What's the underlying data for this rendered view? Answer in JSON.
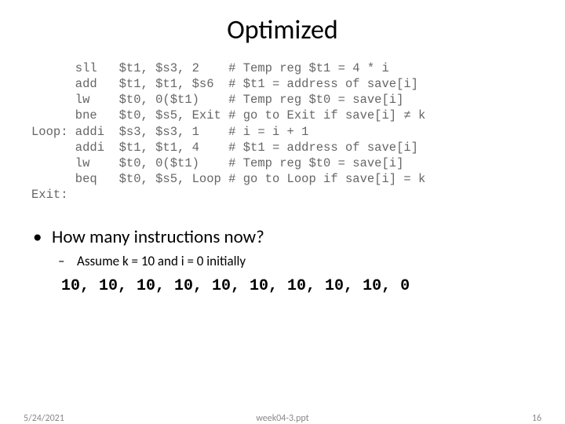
{
  "title": "Optimized",
  "code": "      sll   $t1, $s3, 2    # Temp reg $t1 = 4 * i\n      add   $t1, $t1, $s6  # $t1 = address of save[i]\n      lw    $t0, 0($t1)    # Temp reg $t0 = save[i]\n      bne   $t0, $s5, Exit # go to Exit if save[i] ≠ k\nLoop: addi  $s3, $s3, 1    # i = i + 1\n      addi  $t1, $t1, 4    # $t1 = address of save[i]\n      lw    $t0, 0($t1)    # Temp reg $t0 = save[i]\n      beq   $t0, $s5, Loop # go to Loop if save[i] = k\nExit:",
  "bullets": {
    "l1": "How many instructions now?",
    "l2": "Assume k = 10 and i = 0 initially"
  },
  "answer": "10, 10, 10, 10, 10, 10, 10, 10, 10, 0",
  "footer": {
    "date": "5/24/2021",
    "file": "week04-3.ppt",
    "page": "16"
  }
}
